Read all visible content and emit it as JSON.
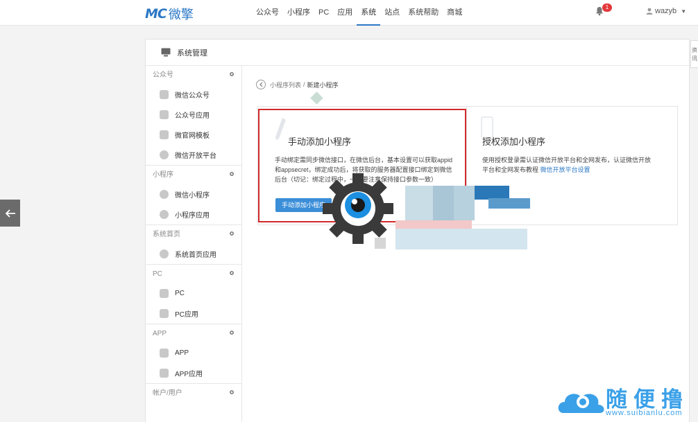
{
  "brand": {
    "mark": "MC",
    "name": "微擎"
  },
  "nav": {
    "items": [
      "公众号",
      "小程序",
      "PC",
      "应用",
      "系统",
      "站点",
      "系统帮助",
      "商城"
    ],
    "active": "系统"
  },
  "notifications": {
    "count": "1"
  },
  "user": {
    "name": "wazyb"
  },
  "panel": {
    "title": "系统管理"
  },
  "sidebar": {
    "groups": [
      {
        "title": "公众号",
        "items": [
          "微信公众号",
          "公众号应用",
          "微官网模板",
          "微信开放平台"
        ]
      },
      {
        "title": "小程序",
        "items": [
          "微信小程序",
          "小程序应用"
        ]
      },
      {
        "title": "系统首页",
        "items": [
          "系统首页应用"
        ]
      },
      {
        "title": "PC",
        "items": [
          "PC",
          "PC应用"
        ]
      },
      {
        "title": "APP",
        "items": [
          "APP",
          "APP应用"
        ]
      },
      {
        "title": "帐户/用户",
        "items": []
      }
    ]
  },
  "breadcrumb": {
    "parent": "小程序列表",
    "separator": "/",
    "current": "新建小程序"
  },
  "manual_card": {
    "title": "手动添加小程序",
    "desc_line1": "手动绑定需同步微信接口，在微信后台，基本设置可以获取appid",
    "desc_line2": "和appsecret，绑定成功后，将获取的服务器配置接口绑定到微信",
    "desc_line3": "后台（切记：绑定过程中，一定要注意保持接口参数一致）",
    "button": "手动添加小程序"
  },
  "auth_card": {
    "title": "授权添加小程序",
    "desc_line1": "使用授权登录需认证微信开放平台和全网发布，认证微信开放",
    "desc_line2": "平台和全网发布教程",
    "link": "微信开放平台设置"
  },
  "side_tab": {
    "text": "资\n讯"
  },
  "watermark": {
    "text": "随便撸",
    "url": "www.suibianlu.com"
  },
  "colors": {
    "accent": "#2b78c5",
    "highlight": "#d22a2a",
    "button": "#3b8ed8",
    "badge": "#e4393c"
  }
}
